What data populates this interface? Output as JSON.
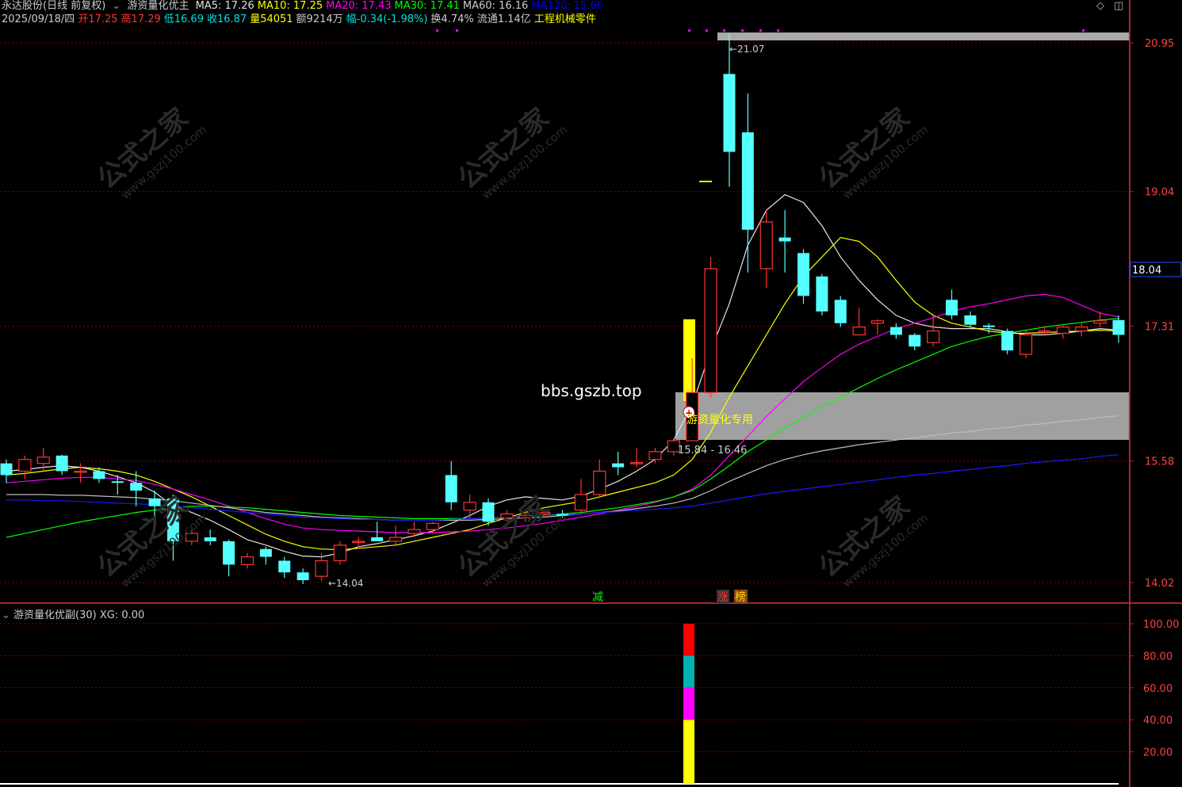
{
  "header": {
    "stock_name": "永达股份(日线 前复权)",
    "indicator_name": "游资量化优主",
    "ma_labels": [
      {
        "text": "MA5: 17.26",
        "color": "#e0e0e0"
      },
      {
        "text": "MA10: 17.25",
        "color": "#ffff00"
      },
      {
        "text": "MA20: 17.43",
        "color": "#ff00ff"
      },
      {
        "text": "MA30: 17.41",
        "color": "#00ff00"
      },
      {
        "text": "MA60: 16.16",
        "color": "#cccccc"
      },
      {
        "text": "MA120: 15.66",
        "color": "#0000ff"
      }
    ],
    "quote_row": [
      {
        "text": "2025/09/18/四",
        "color": "#cccccc"
      },
      {
        "text": "开17.25",
        "color": "#ff3333"
      },
      {
        "text": "高17.29",
        "color": "#ff3333"
      },
      {
        "text": "低16.69",
        "color": "#00e0e0"
      },
      {
        "text": "收16.87",
        "color": "#00e0e0"
      },
      {
        "text": "量54051",
        "color": "#ffff00"
      },
      {
        "text": "额9214万",
        "color": "#cccccc"
      },
      {
        "text": "幅-0.34(-1.98%)",
        "color": "#00e0e0"
      },
      {
        "text": "换4.74%",
        "color": "#cccccc"
      },
      {
        "text": "流通1.14亿",
        "color": "#cccccc"
      },
      {
        "text": "工程机械零件",
        "color": "#ffff00"
      }
    ]
  },
  "watermark": {
    "main": "公式之家",
    "url": "www.gszj100.com"
  },
  "annotations": {
    "site": "bbs.gszb.top",
    "box_label": "游资量化专用",
    "range_label": "15.84 - 16.46",
    "high_label": "21.07",
    "low_label": "14.04",
    "current_price": "18.04",
    "signal_jian": "减",
    "signal_zhang": "涨",
    "signal_bang": "榜"
  },
  "sub_panel": {
    "title": "游资量化优副(30)",
    "xg": "XG: 0.00"
  },
  "colors": {
    "up": "#ff3333",
    "down": "#54ffff",
    "grid": "#8b0000",
    "axis": "#b22222"
  },
  "chart_data": [
    {
      "type": "candlestick",
      "title": "",
      "y_ticks": [
        20.95,
        19.04,
        17.31,
        15.58,
        14.02
      ],
      "ylim": [
        13.8,
        21.3
      ],
      "candles": [
        {
          "o": 15.55,
          "h": 15.6,
          "l": 15.3,
          "c": 15.4
        },
        {
          "o": 15.45,
          "h": 15.65,
          "l": 15.35,
          "c": 15.6
        },
        {
          "o": 15.55,
          "h": 15.75,
          "l": 15.45,
          "c": 15.63
        },
        {
          "o": 15.65,
          "h": 15.66,
          "l": 15.4,
          "c": 15.45
        },
        {
          "o": 15.45,
          "h": 15.55,
          "l": 15.3,
          "c": 15.45
        },
        {
          "o": 15.45,
          "h": 15.5,
          "l": 15.3,
          "c": 15.35
        },
        {
          "o": 15.32,
          "h": 15.4,
          "l": 15.15,
          "c": 15.3
        },
        {
          "o": 15.3,
          "h": 15.45,
          "l": 15.0,
          "c": 15.2
        },
        {
          "o": 15.1,
          "h": 15.2,
          "l": 14.8,
          "c": 15.0
        },
        {
          "o": 15.1,
          "h": 15.15,
          "l": 14.3,
          "c": 14.55
        },
        {
          "o": 14.55,
          "h": 14.7,
          "l": 14.5,
          "c": 14.65
        },
        {
          "o": 14.6,
          "h": 14.7,
          "l": 14.5,
          "c": 14.55
        },
        {
          "o": 14.55,
          "h": 14.57,
          "l": 14.1,
          "c": 14.25
        },
        {
          "o": 14.25,
          "h": 14.4,
          "l": 14.2,
          "c": 14.35
        },
        {
          "o": 14.45,
          "h": 14.48,
          "l": 14.25,
          "c": 14.35
        },
        {
          "o": 14.3,
          "h": 14.35,
          "l": 14.08,
          "c": 14.15
        },
        {
          "o": 14.15,
          "h": 14.2,
          "l": 14.0,
          "c": 14.05
        },
        {
          "o": 14.1,
          "h": 14.4,
          "l": 14.04,
          "c": 14.3
        },
        {
          "o": 14.3,
          "h": 14.55,
          "l": 14.25,
          "c": 14.5
        },
        {
          "o": 14.55,
          "h": 14.6,
          "l": 14.45,
          "c": 14.55
        },
        {
          "o": 14.6,
          "h": 14.8,
          "l": 14.55,
          "c": 14.55
        },
        {
          "o": 14.55,
          "h": 14.75,
          "l": 14.5,
          "c": 14.6
        },
        {
          "o": 14.65,
          "h": 14.8,
          "l": 14.6,
          "c": 14.7
        },
        {
          "o": 14.7,
          "h": 14.8,
          "l": 14.65,
          "c": 14.78
        },
        {
          "o": 15.4,
          "h": 15.58,
          "l": 14.95,
          "c": 15.05
        },
        {
          "o": 14.95,
          "h": 15.15,
          "l": 14.85,
          "c": 15.05
        },
        {
          "o": 15.05,
          "h": 15.1,
          "l": 14.75,
          "c": 14.8
        },
        {
          "o": 14.85,
          "h": 14.95,
          "l": 14.8,
          "c": 14.9
        },
        {
          "o": 14.85,
          "h": 14.95,
          "l": 14.8,
          "c": 14.88
        },
        {
          "o": 14.9,
          "h": 14.95,
          "l": 14.85,
          "c": 14.92
        },
        {
          "o": 14.9,
          "h": 14.95,
          "l": 14.85,
          "c": 14.88
        },
        {
          "o": 14.95,
          "h": 15.35,
          "l": 14.9,
          "c": 15.15
        },
        {
          "o": 15.15,
          "h": 15.6,
          "l": 15.1,
          "c": 15.45
        },
        {
          "o": 15.55,
          "h": 15.7,
          "l": 15.4,
          "c": 15.5
        },
        {
          "o": 15.55,
          "h": 15.75,
          "l": 15.5,
          "c": 15.56
        },
        {
          "o": 15.6,
          "h": 15.75,
          "l": 15.55,
          "c": 15.7
        },
        {
          "o": 15.7,
          "h": 15.85,
          "l": 15.65,
          "c": 15.84
        },
        {
          "o": 15.84,
          "h": 16.9,
          "l": 15.84,
          "c": 16.46
        },
        {
          "o": 16.46,
          "h": 18.2,
          "l": 16.4,
          "c": 18.05
        },
        {
          "o": 20.55,
          "h": 21.07,
          "l": 19.1,
          "c": 19.55
        },
        {
          "o": 19.8,
          "h": 20.3,
          "l": 18.0,
          "c": 18.55
        },
        {
          "o": 18.05,
          "h": 18.8,
          "l": 17.8,
          "c": 18.65
        },
        {
          "o": 18.45,
          "h": 18.8,
          "l": 18.0,
          "c": 18.4
        },
        {
          "o": 18.25,
          "h": 18.3,
          "l": 17.6,
          "c": 17.7
        },
        {
          "o": 17.95,
          "h": 17.98,
          "l": 17.45,
          "c": 17.5
        },
        {
          "o": 17.65,
          "h": 17.7,
          "l": 17.3,
          "c": 17.35
        },
        {
          "o": 17.2,
          "h": 17.55,
          "l": 17.2,
          "c": 17.3
        },
        {
          "o": 17.35,
          "h": 17.4,
          "l": 17.2,
          "c": 17.38
        },
        {
          "o": 17.3,
          "h": 17.35,
          "l": 17.15,
          "c": 17.2
        },
        {
          "o": 17.2,
          "h": 17.22,
          "l": 17.0,
          "c": 17.05
        },
        {
          "o": 17.1,
          "h": 17.45,
          "l": 17.05,
          "c": 17.25
        },
        {
          "o": 17.65,
          "h": 17.78,
          "l": 17.4,
          "c": 17.45
        },
        {
          "o": 17.45,
          "h": 17.5,
          "l": 17.3,
          "c": 17.33
        },
        {
          "o": 17.32,
          "h": 17.35,
          "l": 17.22,
          "c": 17.3
        },
        {
          "o": 17.25,
          "h": 17.28,
          "l": 16.95,
          "c": 17.0
        },
        {
          "o": 16.95,
          "h": 17.25,
          "l": 16.9,
          "c": 17.2
        },
        {
          "o": 17.25,
          "h": 17.3,
          "l": 17.2,
          "c": 17.25
        },
        {
          "o": 17.22,
          "h": 17.32,
          "l": 17.15,
          "c": 17.3
        },
        {
          "o": 17.25,
          "h": 17.35,
          "l": 17.18,
          "c": 17.3
        },
        {
          "o": 17.35,
          "h": 17.5,
          "l": 17.3,
          "c": 17.38
        },
        {
          "o": 17.39,
          "h": 17.45,
          "l": 17.1,
          "c": 17.2
        }
      ],
      "ma_lines": [
        {
          "name": "MA5",
          "color": "#e6e6e6",
          "values": [
            15.45,
            15.47,
            15.5,
            15.52,
            15.5,
            15.45,
            15.38,
            15.3,
            15.18,
            15.0,
            14.92,
            14.82,
            14.7,
            14.57,
            14.5,
            14.42,
            14.36,
            14.35,
            14.4,
            14.48,
            14.52,
            14.57,
            14.62,
            14.68,
            14.78,
            14.88,
            15.0,
            15.08,
            15.12,
            15.1,
            15.08,
            15.13,
            15.22,
            15.32,
            15.45,
            15.6,
            15.85,
            16.3,
            17.0,
            17.6,
            18.35,
            18.8,
            19.0,
            18.9,
            18.6,
            18.2,
            17.9,
            17.65,
            17.45,
            17.35,
            17.3,
            17.28,
            17.28,
            17.28,
            17.24,
            17.2,
            17.2,
            17.22,
            17.25,
            17.28,
            17.26
          ]
        },
        {
          "name": "MA10",
          "color": "#ffff00",
          "values": [
            15.4,
            15.42,
            15.45,
            15.48,
            15.5,
            15.48,
            15.45,
            15.4,
            15.32,
            15.22,
            15.12,
            15.0,
            14.88,
            14.76,
            14.64,
            14.55,
            14.48,
            14.45,
            14.44,
            14.46,
            14.48,
            14.5,
            14.55,
            14.6,
            14.65,
            14.7,
            14.78,
            14.85,
            14.92,
            14.98,
            15.02,
            15.06,
            15.12,
            15.18,
            15.24,
            15.3,
            15.4,
            15.6,
            15.95,
            16.4,
            16.8,
            17.2,
            17.6,
            17.95,
            18.2,
            18.45,
            18.4,
            18.2,
            17.9,
            17.62,
            17.45,
            17.35,
            17.3,
            17.25,
            17.22,
            17.22,
            17.23,
            17.24,
            17.25,
            17.26,
            17.25
          ]
        },
        {
          "name": "MA20",
          "color": "#ff00ff",
          "values": [
            15.3,
            15.32,
            15.34,
            15.36,
            15.37,
            15.37,
            15.35,
            15.33,
            15.28,
            15.22,
            15.15,
            15.08,
            15.0,
            14.92,
            14.84,
            14.77,
            14.72,
            14.7,
            14.69,
            14.68,
            14.67,
            14.66,
            14.66,
            14.66,
            14.67,
            14.68,
            14.7,
            14.72,
            14.75,
            14.78,
            14.82,
            14.86,
            14.9,
            14.95,
            15.0,
            15.05,
            15.12,
            15.22,
            15.4,
            15.65,
            15.9,
            16.15,
            16.38,
            16.6,
            16.78,
            16.95,
            17.08,
            17.18,
            17.28,
            17.35,
            17.42,
            17.5,
            17.56,
            17.6,
            17.65,
            17.7,
            17.72,
            17.68,
            17.58,
            17.48,
            17.43
          ]
        },
        {
          "name": "MA30",
          "color": "#00ff00",
          "values": [
            14.6,
            14.65,
            14.7,
            14.75,
            14.8,
            14.84,
            14.88,
            14.92,
            14.95,
            14.98,
            15.0,
            15.0,
            14.99,
            14.98,
            14.96,
            14.94,
            14.92,
            14.9,
            14.88,
            14.87,
            14.86,
            14.85,
            14.84,
            14.84,
            14.84,
            14.84,
            14.85,
            14.86,
            14.87,
            14.88,
            14.9,
            14.92,
            14.95,
            14.98,
            15.02,
            15.06,
            15.12,
            15.2,
            15.35,
            15.52,
            15.7,
            15.85,
            16.0,
            16.14,
            16.28,
            16.4,
            16.52,
            16.64,
            16.75,
            16.85,
            16.95,
            17.05,
            17.12,
            17.18,
            17.22,
            17.26,
            17.3,
            17.33,
            17.36,
            17.39,
            17.41
          ]
        },
        {
          "name": "MA60",
          "color": "#bdbdbd",
          "values": [
            15.15,
            15.15,
            15.15,
            15.14,
            15.14,
            15.13,
            15.12,
            15.11,
            15.09,
            15.07,
            15.04,
            15.01,
            14.98,
            14.95,
            14.92,
            14.9,
            14.88,
            14.86,
            14.85,
            14.84,
            14.83,
            14.82,
            14.82,
            14.82,
            14.82,
            14.82,
            14.83,
            14.84,
            14.85,
            14.86,
            14.88,
            14.9,
            14.92,
            14.94,
            14.97,
            15.0,
            15.04,
            15.1,
            15.2,
            15.32,
            15.42,
            15.52,
            15.6,
            15.66,
            15.71,
            15.75,
            15.79,
            15.82,
            15.85,
            15.88,
            15.91,
            15.94,
            15.96,
            15.99,
            16.01,
            16.04,
            16.06,
            16.09,
            16.11,
            16.14,
            16.16
          ]
        },
        {
          "name": "MA120",
          "color": "#1a1aff",
          "values": [
            15.08,
            15.08,
            15.07,
            15.07,
            15.06,
            15.05,
            15.04,
            15.03,
            15.02,
            15.0,
            14.98,
            14.96,
            14.94,
            14.92,
            14.9,
            14.88,
            14.86,
            14.85,
            14.84,
            14.83,
            14.83,
            14.82,
            14.82,
            14.82,
            14.83,
            14.84,
            14.85,
            14.86,
            14.87,
            14.88,
            14.89,
            14.9,
            14.92,
            14.93,
            14.95,
            14.96,
            14.98,
            15.0,
            15.04,
            15.08,
            15.12,
            15.16,
            15.19,
            15.22,
            15.25,
            15.28,
            15.31,
            15.34,
            15.37,
            15.4,
            15.42,
            15.45,
            15.47,
            15.5,
            15.52,
            15.55,
            15.57,
            15.59,
            15.61,
            15.64,
            15.66
          ]
        }
      ]
    },
    {
      "type": "bar",
      "title": "",
      "y_ticks": [
        100.0,
        80.0,
        60.0,
        40.0,
        20.0
      ],
      "ylim": [
        0,
        110
      ],
      "stacked_bar": {
        "segments": [
          {
            "from": 0,
            "to": 40,
            "color": "#ffff00"
          },
          {
            "from": 40,
            "to": 60,
            "color": "#ff00ff"
          },
          {
            "from": 60,
            "to": 80,
            "color": "#00b2b2"
          },
          {
            "from": 80,
            "to": 100,
            "color": "#ff0000"
          }
        ]
      }
    }
  ]
}
